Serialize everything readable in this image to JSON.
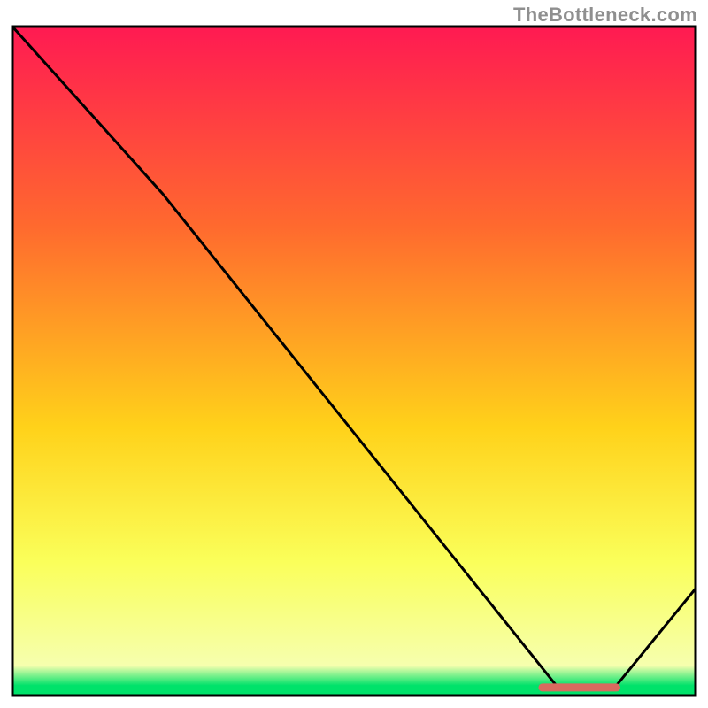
{
  "attribution": "TheBottleneck.com",
  "colors": {
    "gradient_top": "#ff1a52",
    "gradient_mid_upper": "#ff6a2e",
    "gradient_mid": "#ffd21a",
    "gradient_mid_lower": "#faff5a",
    "gradient_green": "#00e26a",
    "curve": "#000000",
    "marker": "#d96a5f",
    "frame": "#000000"
  },
  "chart_data": {
    "type": "line",
    "title": "",
    "xlabel": "",
    "ylabel": "",
    "xlim": [
      0,
      100
    ],
    "ylim": [
      0,
      100
    ],
    "x": [
      0,
      22,
      80,
      88,
      100
    ],
    "values": [
      100,
      75,
      1,
      1,
      16
    ],
    "marker": {
      "x_start": 77,
      "x_end": 89,
      "y": 1.2
    },
    "gradient_stops": [
      {
        "offset": 0.0,
        "color": "#ff1a52"
      },
      {
        "offset": 0.3,
        "color": "#ff6a2e"
      },
      {
        "offset": 0.6,
        "color": "#ffd21a"
      },
      {
        "offset": 0.8,
        "color": "#faff5a"
      },
      {
        "offset": 0.955,
        "color": "#f6ffae"
      },
      {
        "offset": 0.985,
        "color": "#00e26a"
      },
      {
        "offset": 1.0,
        "color": "#00e26a"
      }
    ]
  }
}
